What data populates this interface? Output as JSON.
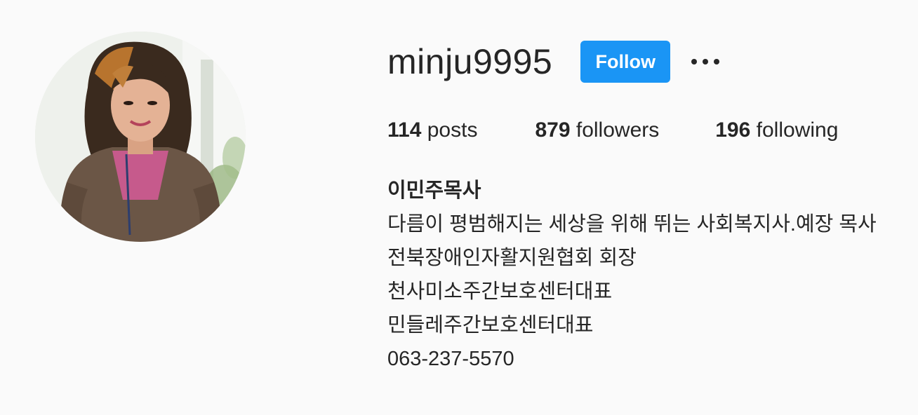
{
  "profile": {
    "username": "minju9995",
    "follow_label": "Follow",
    "more_icon": "more-options-icon",
    "avatar_icon": "profile-photo"
  },
  "stats": {
    "posts_count": "114",
    "posts_label": "posts",
    "followers_count": "879",
    "followers_label": "followers",
    "following_count": "196",
    "following_label": "following"
  },
  "bio": {
    "full_name": "이민주목사",
    "lines": [
      "다름이 평범해지는 세상을 위해 뛰는 사회복지사.예장 목사",
      "전북장애인자활지원협회 회장",
      "천사미소주간보호센터대표",
      "민들레주간보호센터대표",
      "063-237-5570"
    ]
  },
  "colors": {
    "background": "#fafafa",
    "text": "#262626",
    "follow_button": "#1a95f5",
    "follow_text": "#ffffff"
  }
}
